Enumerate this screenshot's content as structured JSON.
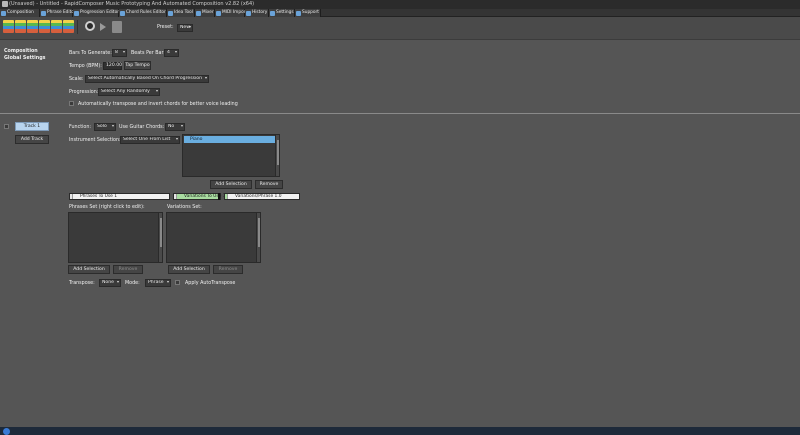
{
  "window": {
    "title": "(Unsaved) - Untitled - RapidComposer Music Prototyping And Automated Composition v2.82 (x64)"
  },
  "tabs": [
    {
      "label": "Composition"
    },
    {
      "label": "Phrase Editor"
    },
    {
      "label": "Progression Editor"
    },
    {
      "label": "Chord Rules Editor"
    },
    {
      "label": "Idea Tool"
    },
    {
      "label": "Mixer"
    },
    {
      "label": "MIDI Import"
    },
    {
      "label": "History"
    },
    {
      "label": "Settings"
    },
    {
      "label": "Support"
    }
  ],
  "toolbar": {
    "preset_label": "Preset:",
    "preset_value": "New"
  },
  "global": {
    "heading_line1": "Composition",
    "heading_line2": "Global Settings",
    "bars_label": "Bars To Generate:",
    "bars_value": "8",
    "beats_label": "Beats Per Bar:",
    "beats_value": "4",
    "tempo_label": "Tempo (BPM):",
    "tempo_value": "120.00",
    "tap_tempo": "Tap Tempo",
    "scale_label": "Scale:",
    "scale_value": "Select Automatically Based On Chord Progression",
    "progression_label": "Progression:",
    "progression_value": "Select Any Randomly",
    "auto_transpose": "Automatically transpose and invert chords for better voice leading"
  },
  "tracks": {
    "track1": "Track 1",
    "add_track": "Add Track"
  },
  "track": {
    "function_label": "Function:",
    "function_value": "Solo",
    "guitar_label": "Use Guitar Chords:",
    "guitar_value": "No",
    "instrument_label": "Instrument Selection:",
    "instrument_value": "Select One From List",
    "instrument_item": "Piano",
    "add_selection": "Add Selection",
    "remove": "Remove",
    "phrases_to_use": "Phrases To Use 1",
    "variations_to_use": "Variations To Use 7",
    "variations_per_phrase": "Variations/Phrase 1.0",
    "phrases_set": "Phrases Set (right click to edit):",
    "variations_set": "Variations Set:",
    "transpose_label": "Transpose:",
    "transpose_value": "None",
    "mode_label": "Mode:",
    "mode_value": "Phrase",
    "apply_auto": "Apply AutoTranspose"
  },
  "colors": {
    "accent_selected": "#6aaee0",
    "green_panel": "#a8dca0",
    "track_button": "#b8d4ee"
  }
}
